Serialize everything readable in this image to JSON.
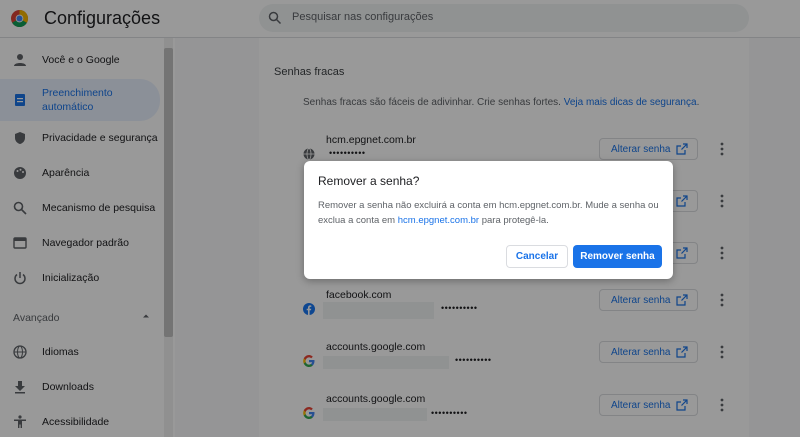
{
  "header": {
    "title": "Configurações",
    "search_placeholder": "Pesquisar nas configurações"
  },
  "sidebar": {
    "items": [
      {
        "label": "Você e o Google",
        "icon": "person-icon"
      },
      {
        "label_line1": "Preenchimento",
        "label_line2": "automático",
        "icon": "clipboard-icon",
        "active": true
      },
      {
        "label": "Privacidade e segurança",
        "icon": "shield-icon"
      },
      {
        "label": "Aparência",
        "icon": "palette-icon"
      },
      {
        "label": "Mecanismo de pesquisa",
        "icon": "search-icon"
      },
      {
        "label": "Navegador padrão",
        "icon": "browser-icon"
      },
      {
        "label": "Inicialização",
        "icon": "power-icon"
      }
    ],
    "advanced_label": "Avançado",
    "advanced_items": [
      {
        "label": "Idiomas",
        "icon": "globe-icon"
      },
      {
        "label": "Downloads",
        "icon": "download-icon"
      },
      {
        "label": "Acessibilidade",
        "icon": "accessibility-icon"
      }
    ]
  },
  "main": {
    "section_title": "Senhas fracas",
    "description": "Senhas fracas são fáceis de adivinhar. Crie senhas fortes.",
    "description_link": "Veja mais dicas de segurança",
    "change_label": "Alterar senha",
    "rows": [
      {
        "site": "hcm.epgnet.com.br",
        "password_mask": "••••••••••",
        "icon": "globe-icon"
      },
      {
        "site": "facebook.com",
        "password_mask": "••••••••••",
        "icon": "facebook-icon"
      },
      {
        "site": "accounts.google.com",
        "password_mask": "••••••••••",
        "icon": "google-icon"
      },
      {
        "site": "accounts.google.com",
        "password_mask": "••••••••••",
        "icon": "google-icon"
      }
    ]
  },
  "dialog": {
    "title": "Remover a senha?",
    "body_part1": "Remover a senha não excluirá a conta em hcm.epgnet.com.br. Mude a senha ou exclua a conta em ",
    "body_link": "hcm.epgnet.com.br",
    "body_part2": " para protegê-la.",
    "cancel_label": "Cancelar",
    "remove_label": "Remover senha"
  },
  "colors": {
    "accent": "#1a73e8",
    "active_bg": "#e8f0fe"
  }
}
